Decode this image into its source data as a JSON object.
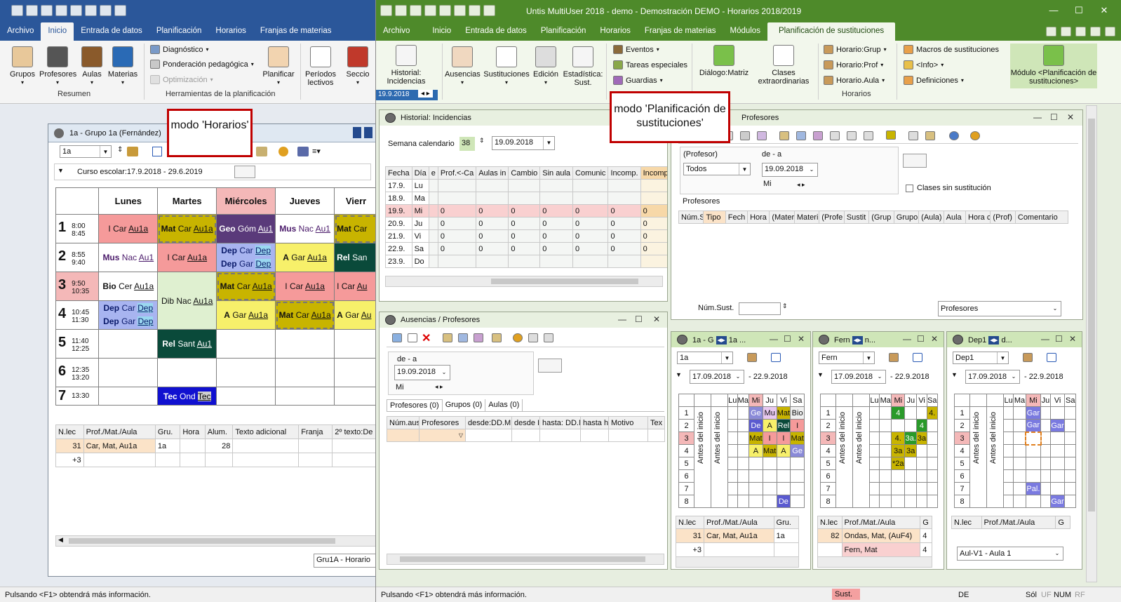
{
  "left": {
    "title": "",
    "tabs": [
      "Archivo",
      "Inicio",
      "Entrada de datos",
      "Planificación",
      "Horarios",
      "Franjas de materias"
    ],
    "ribbon": {
      "buttons": [
        "Grupos",
        "Profesores",
        "Aulas",
        "Materias"
      ],
      "group_resumen": "Resumen",
      "small": [
        "Diagnóstico",
        "Ponderación pedagógica",
        "Optimización"
      ],
      "planificar": "Planificar",
      "periodos": "Períodos lectivos",
      "seccion": "Seccio",
      "group_herr": "Herramientas de la planificación"
    },
    "callout": "modo 'Horarios'",
    "window": {
      "title": "1a - Grupo 1a (Fernández)",
      "select": "1a",
      "course": "Curso escolar:17.9.2018 - 29.6.2019",
      "days": [
        "Lunes",
        "Martes",
        "Miércoles",
        "Jueves",
        "Vierr"
      ],
      "periods": [
        {
          "n": "1",
          "start": "8:00",
          "end": "8:45"
        },
        {
          "n": "2",
          "start": "8:55",
          "end": "9:40"
        },
        {
          "n": "3",
          "start": "9:50",
          "end": "10:35"
        },
        {
          "n": "4",
          "start": "10:45",
          "end": "11:30"
        },
        {
          "n": "5",
          "start": "11:40",
          "end": "12:25"
        },
        {
          "n": "6",
          "start": "12:35",
          "end": "13:20"
        },
        {
          "n": "7",
          "start": "13:30",
          "end": ""
        }
      ],
      "cells": {
        "r1c1": [
          "I",
          "Car",
          "Au1a"
        ],
        "r1c2": [
          "Mat",
          "Car",
          "Au1a"
        ],
        "r1c3": [
          "Geo",
          "Góm",
          "Au1"
        ],
        "r1c4": [
          "Mus",
          "Nac",
          "Au1"
        ],
        "r1c5": [
          "Mat",
          "Car",
          ""
        ],
        "r2c1": [
          "Mus",
          "Nac",
          "Au1"
        ],
        "r2c2": [
          "I",
          "Car",
          "Au1a"
        ],
        "r2c3a": [
          "Dep",
          "Car",
          "Dep"
        ],
        "r2c3b": [
          "Dep",
          "Gar",
          "Dep"
        ],
        "r2c4": [
          "A",
          "Gar",
          "Au1a"
        ],
        "r2c5": [
          "Rel",
          "San",
          ""
        ],
        "r3c1": [
          "Bio",
          "Cer",
          "Au1a"
        ],
        "r3c2": [
          "Dib",
          "Nac",
          "Au1a"
        ],
        "r3c3": [
          "Mat",
          "Car",
          "Au1a"
        ],
        "r3c4": [
          "I",
          "Car",
          "Au1a"
        ],
        "r3c5": [
          "I",
          "Car",
          "Au"
        ],
        "r4c1a": [
          "Dep",
          "Car",
          "Dep"
        ],
        "r4c1b": [
          "Dep",
          "Gar",
          "Dep"
        ],
        "r4c3": [
          "A",
          "Gar",
          "Au1a"
        ],
        "r4c4": [
          "Mat",
          "Car",
          "Au1a"
        ],
        "r4c5": [
          "A",
          "Gar",
          "Au"
        ],
        "r5c2": [
          "Rel",
          "Sant",
          "Au1"
        ],
        "r7c2": [
          "Tec",
          "Ond",
          "Tec"
        ]
      },
      "bottom_headers": [
        "N.lec",
        "Prof./Mat./Aula",
        "Gru.",
        "Hora",
        "Alum.",
        "Texto adicional",
        "Franja",
        "2º texto:De"
      ],
      "bottom_row1": [
        "31",
        "Car, Mat, Au1a",
        "1a",
        "",
        "28",
        "",
        "",
        ""
      ],
      "bottom_row2": [
        "+3",
        "",
        "",
        "",
        "",
        "",
        "",
        ""
      ],
      "footer_select": "Gru1A - Horario"
    },
    "status": "Pulsando <F1> obtendrá más información."
  },
  "right": {
    "title": "Untis MultiUser 2018 - demo  -  Demostración  DEMO  -  Horarios 2018/2019",
    "tabs": [
      "Archivo",
      "Inicio",
      "Entrada de datos",
      "Planificación",
      "Horarios",
      "Franjas de materias",
      "Módulos",
      "Planificación de sustituciones"
    ],
    "ribbon": {
      "historial": "Historial: Incidencias",
      "date": "19.9.2018",
      "ausencias": "Ausencias",
      "sustituciones": "Sustituciones",
      "edicion": "Edición",
      "estadistica": "Estadística: Sust.",
      "small1": [
        "Eventos",
        "Tareas especiales",
        "Guardias"
      ],
      "dialogo": "Diálogo:Matriz",
      "clases": "Clases extraordinarias",
      "small2": [
        "Horario:Grup",
        "Horario:Prof",
        "Horario.Aula"
      ],
      "group_horarios": "Horarios",
      "small3": [
        "Macros de sustituciones",
        "<Info>",
        "Definiciones"
      ],
      "modulo": "Módulo <Planificación de sustituciones>"
    },
    "callout": "modo 'Planificación de sustituciones'",
    "historial": {
      "title": "Historial: Incidencias",
      "semana_label": "Semana calendario",
      "semana": "38",
      "date": "19.09.2018",
      "headers": [
        "Fecha",
        "Día",
        "e",
        "Prof.<-Ca",
        "Aulas in",
        "Cambio",
        "Sin aula",
        "Comunic",
        "Incomp.",
        "Incomp."
      ],
      "rows": [
        [
          "17.9.",
          "Lu",
          "",
          "",
          "",
          "",
          "",
          "",
          "",
          ""
        ],
        [
          "18.9.",
          "Ma",
          "",
          "",
          "",
          "",
          "",
          "",
          "",
          ""
        ],
        [
          "19.9.",
          "Mi",
          "",
          "0",
          "0",
          "0",
          "0",
          "0",
          "0",
          "0"
        ],
        [
          "20.9.",
          "Ju",
          "",
          "0",
          "0",
          "0",
          "0",
          "0",
          "0",
          "0"
        ],
        [
          "21.9.",
          "Vi",
          "",
          "0",
          "0",
          "0",
          "0",
          "0",
          "0",
          "0"
        ],
        [
          "22.9.",
          "Sa",
          "",
          "0",
          "0",
          "0",
          "0",
          "0",
          "0",
          "0"
        ],
        [
          "23.9.",
          "Do",
          "",
          "",
          "",
          "",
          "",
          "",
          "",
          ""
        ]
      ]
    },
    "sustit": {
      "title": "Profesores",
      "prof_label": "(Profesor)",
      "prof_value": "Todos",
      "de_a": "de - a",
      "date": "19.09.2018",
      "mi": "Mi",
      "clases_sin": "Clases sin sustitución",
      "profesores_label": "Profesores",
      "headers": [
        "Núm.S",
        "Tipo",
        "Fech",
        "Hora",
        "(Mater",
        "Materi",
        "(Profe",
        "Sustit",
        "(Grup",
        "Grupo",
        "(Aula)",
        "Aula",
        "Hora c",
        "(Prof)",
        "Comentario"
      ],
      "num_sust": "Núm.Sust.",
      "select": "Profesores"
    },
    "ausencias": {
      "title": "Ausencias / Profesores",
      "de_a": "de - a",
      "date": "19.09.2018",
      "mi": "Mi",
      "tabs": [
        "Profesores (0)",
        "Grupos (0)",
        "Aulas (0)"
      ],
      "headers": [
        "Núm.aus",
        "Profesores",
        "desde:DD.M",
        "desde I",
        "hasta: DD.MI",
        "hasta h",
        "Motivo",
        "Tex"
      ]
    },
    "mini": [
      {
        "title": "1a - G",
        "title2": "1a ...",
        "select": "1a",
        "from": "17.09.2018",
        "to": "- 22.9.2018",
        "days": [
          "Lu",
          "Ma",
          "Mi",
          "Ju",
          "Vi",
          "Sa"
        ],
        "cells": {
          "1-3": "Ge",
          "1-4": "Mu",
          "1-5": "Mat",
          "1-6": "Bio",
          "2-3": "De",
          "2-4": "A",
          "2-5": "Rel",
          "2-6": "I",
          "3-3": "Mat",
          "3-4": "I",
          "3-5": "I",
          "3-6": "Mat",
          "4-3": "A",
          "4-4": "Mat",
          "4-5": "A",
          "4-6": "Ge",
          "8-5": "De"
        },
        "side1": "Antes del inicio",
        "side2": "Antes del inicio",
        "bheaders": [
          "N.lec",
          "Prof./Mat./Aula",
          "Gru."
        ],
        "brow1": [
          "31",
          "Car, Mat, Au1a",
          "1a"
        ],
        "brow2": [
          "+3",
          "",
          ""
        ]
      },
      {
        "title": "Fern",
        "title2": "n...",
        "select": "Fern",
        "from": "17.09.2018",
        "to": "- 22.9.2018",
        "days": [
          "Lu",
          "Ma",
          "Mi",
          "Ju",
          "Vi",
          "Sa"
        ],
        "cells": {
          "1-3": "4",
          "1-6": "4.",
          "2-5": "4",
          "3-3": "4.",
          "3-4": "3a.",
          "3-5": "3a",
          "4-3": "3a",
          "4-4": "3a",
          "5-3": "*2a"
        },
        "side1": "Antes del inicio",
        "side2": "Antes del inicio",
        "bheaders": [
          "N.lec",
          "Prof./Mat./Aula",
          "G"
        ],
        "brow1": [
          "82",
          "Ondas, Mat, (AuF4)",
          "4"
        ],
        "brow2": [
          "",
          "Fern, Mat",
          "4"
        ]
      },
      {
        "title": "Dep1",
        "title2": "d...",
        "select": "Dep1",
        "from": "17.09.2018",
        "to": "- 22.9.2018",
        "days": [
          "Lu",
          "Ma",
          "Mi",
          "Ju",
          "Vi",
          "Sa"
        ],
        "cells": {
          "1-3": "Gar",
          "2-3": "Gar",
          "2-5": "Gar",
          "7-3": "Pal.",
          "8-5": "Gar"
        },
        "side1": "Antes del inicio",
        "side2": "Antes del inicio",
        "bheaders": [
          "N.lec",
          "Prof./Mat./Aula",
          "G"
        ],
        "select2": "Aul-V1 - Aula 1"
      }
    ],
    "status": "Pulsando <F1> obtendrá más información.",
    "status_sust": "Sust.",
    "status_de": "DE",
    "status_sol": "Sól",
    "status_uf": "UF",
    "status_num": "NUM",
    "status_rf": "RF"
  }
}
